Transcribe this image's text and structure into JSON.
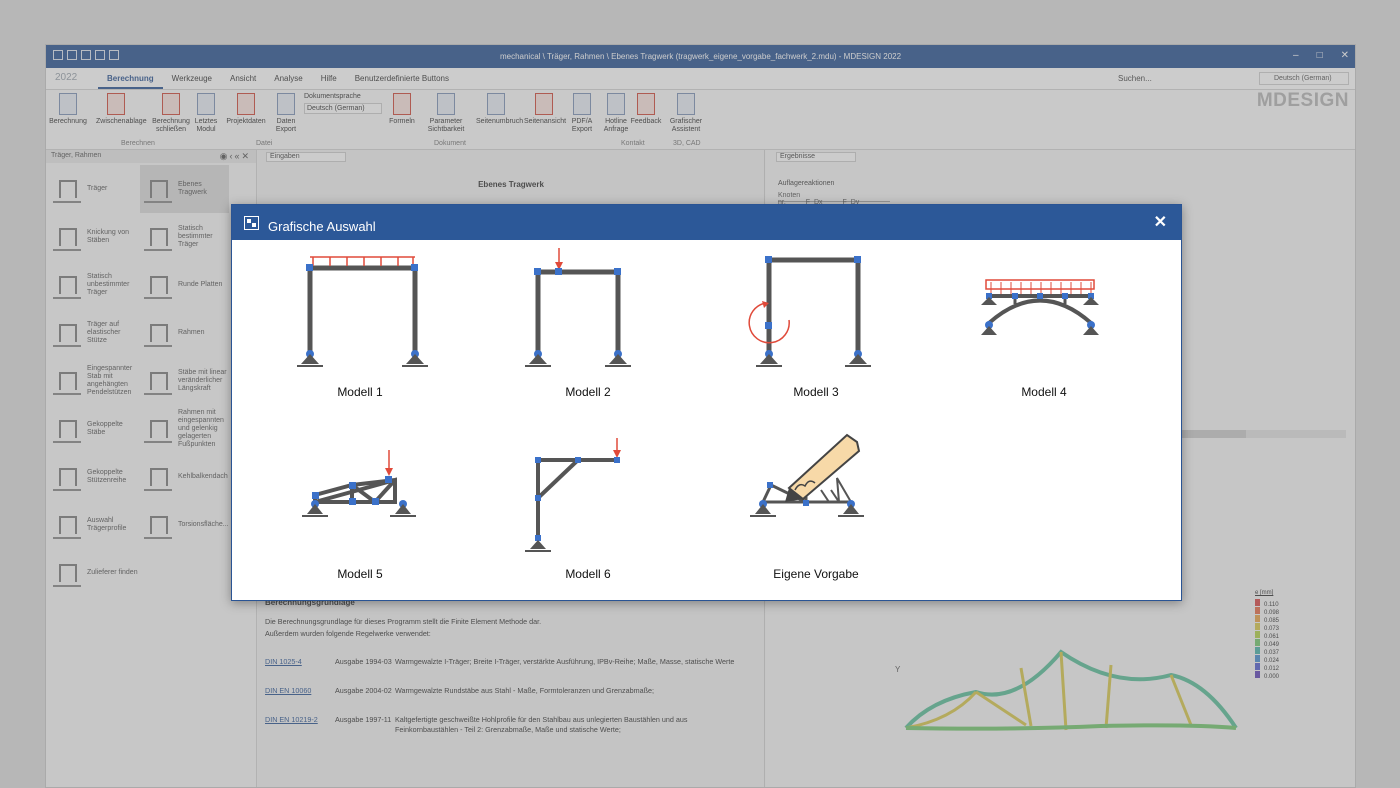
{
  "window": {
    "title": "mechanical \\ Träger, Rahmen \\ Ebenes Tragwerk (tragwerk_eigene_vorgabe_fachwerk_2.mdu) - MDESIGN 2022"
  },
  "menu": {
    "year": "2022",
    "tabs": [
      "Berechnung",
      "Werkzeuge",
      "Ansicht",
      "Analyse",
      "Hilfe",
      "Benutzerdefinierte Buttons"
    ],
    "search": "Suchen...",
    "language": "Deutsch (German)"
  },
  "ribbon": {
    "buttons": [
      "Berechnung",
      "Zwischenablage",
      "Berechnung schließen",
      "Letztes Modul",
      "Projektdaten",
      "Daten Export",
      "Formeln",
      "Parameter Sichtbarkeit",
      "Seitenumbruch",
      "Seitenansicht",
      "PDF/A Export",
      "Hotline Anfrage",
      "Feedback",
      "Grafischer Assistent"
    ],
    "groups": [
      "Berechnen",
      "Datei",
      "Dokument",
      "Kontakt",
      "3D, CAD"
    ],
    "doc_language_label": "Dokumentsprache",
    "doc_language_value": "Deutsch (German)"
  },
  "logo": "MDESIGN",
  "left_pane": {
    "title": "Träger, Rahmen",
    "items": [
      "Träger",
      "Ebenes Tragwerk",
      "Knickung von Stäben",
      "Statisch bestimmter Träger",
      "Statisch unbestimmter Träger",
      "Runde Platten",
      "Träger auf elastischer Stütze",
      "Rahmen",
      "Eingespannter Stab mit angehängten Pendelstützen",
      "Stäbe mit linear veränderlicher Längskraft",
      "Gekoppelte Stäbe",
      "Rahmen mit eingespannten und gelenkig gelagerten Fußpunkten",
      "Gekoppelte Stützenreihe",
      "Kehlbalkendach",
      "Auswahl Trägerprofile",
      "Torsionsfläche...",
      "Zulieferer finden"
    ]
  },
  "middle_pane": {
    "combo": "Eingaben",
    "doc_title": "Ebenes Tragwerk",
    "section_title": "Berechnungsgrundlage",
    "text1": "Die Berechnungsgrundlage für dieses Programm stellt die Finite Element Methode dar.",
    "text2": "Außerdem wurden folgende Regelwerke verwendet:",
    "standards": [
      {
        "code": "DIN 1025-4",
        "edition": "Ausgabe 1994-03",
        "desc": "Warmgewalzte I-Träger; Breite I-Träger, verstärkte Ausführung, IPBv-Reihe; Maße, Masse, statische Werte"
      },
      {
        "code": "DIN EN 10060",
        "edition": "Ausgabe 2004-02",
        "desc": "Warmgewalzte Rundstäbe aus Stahl - Maße, Formtoleranzen und Grenzabmaße;"
      },
      {
        "code": "DIN EN 10219-2",
        "edition": "Ausgabe 1997-11",
        "desc": "Kaltgefertigte geschweißte Hohlprofile für den Stahlbau aus unlegierten Baustählen und aus Feinkornbaustählen - Teil 2: Grenzabmaße, Maße und statische Werte;"
      }
    ]
  },
  "right_pane": {
    "combo": "Ergebnisse",
    "label": "Auflagereaktionen",
    "table_headers": [
      "Knoten nr.",
      "F_Dx",
      "F_Dy"
    ],
    "legend_title": "e [mm]",
    "legend": [
      "0.110",
      "0.098",
      "0.085",
      "0.073",
      "0.061",
      "0.049",
      "0.037",
      "0.024",
      "0.012",
      "0.000"
    ],
    "legend_colors": [
      "#d94848",
      "#e56d4a",
      "#e8a44a",
      "#d8c94c",
      "#b3d24a",
      "#74c970",
      "#4bb4aa",
      "#4a8fd0",
      "#5560d0",
      "#6046b8"
    ]
  },
  "dialog": {
    "title": "Grafische Auswahl",
    "close": "✕",
    "models": [
      "Modell 1",
      "Modell 2",
      "Modell 3",
      "Modell 4",
      "Modell 5",
      "Modell 6",
      "Eigene Vorgabe"
    ]
  }
}
